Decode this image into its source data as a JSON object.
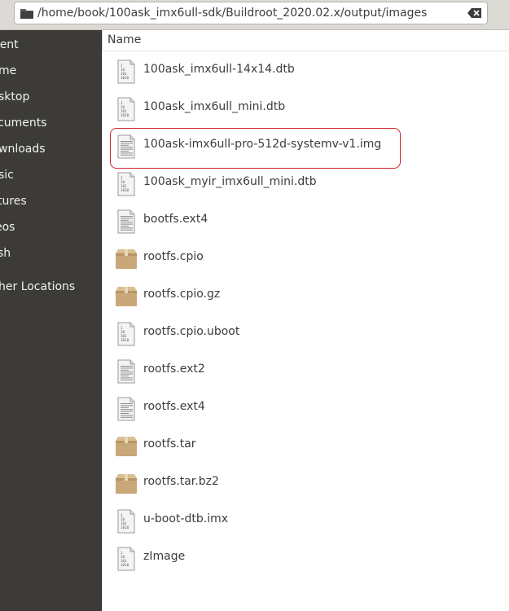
{
  "location": {
    "path": "/home/book/100ask_imx6ull-sdk/Buildroot_2020.02.x/output/images"
  },
  "sidebar": {
    "items": [
      {
        "label": "cent"
      },
      {
        "label": "me"
      },
      {
        "label": "sktop"
      },
      {
        "label": "cuments"
      },
      {
        "label": "wnloads"
      },
      {
        "label": "sic"
      },
      {
        "label": "tures"
      },
      {
        "label": "eos"
      },
      {
        "label": "sh"
      },
      {
        "label": "her Locations"
      }
    ]
  },
  "list": {
    "column_name": "Name",
    "files": [
      {
        "name": "100ask_imx6ull-14x14.dtb",
        "icon": "binary-file-icon"
      },
      {
        "name": "100ask_imx6ull_mini.dtb",
        "icon": "binary-file-icon"
      },
      {
        "name": "100ask-imx6ull-pro-512d-systemv-v1.img",
        "icon": "text-file-icon"
      },
      {
        "name": "100ask_myir_imx6ull_mini.dtb",
        "icon": "binary-file-icon"
      },
      {
        "name": "bootfs.ext4",
        "icon": "text-file-icon"
      },
      {
        "name": "rootfs.cpio",
        "icon": "package-icon"
      },
      {
        "name": "rootfs.cpio.gz",
        "icon": "package-icon"
      },
      {
        "name": "rootfs.cpio.uboot",
        "icon": "binary-file-icon"
      },
      {
        "name": "rootfs.ext2",
        "icon": "text-file-icon"
      },
      {
        "name": "rootfs.ext4",
        "icon": "text-file-icon"
      },
      {
        "name": "rootfs.tar",
        "icon": "package-icon"
      },
      {
        "name": "rootfs.tar.bz2",
        "icon": "package-icon"
      },
      {
        "name": "u-boot-dtb.imx",
        "icon": "binary-file-icon"
      },
      {
        "name": "zImage",
        "icon": "binary-file-icon"
      }
    ]
  },
  "colors": {
    "sidebar_bg": "#3c3b37",
    "highlight": "#d2232a",
    "package": "#c8a878"
  }
}
